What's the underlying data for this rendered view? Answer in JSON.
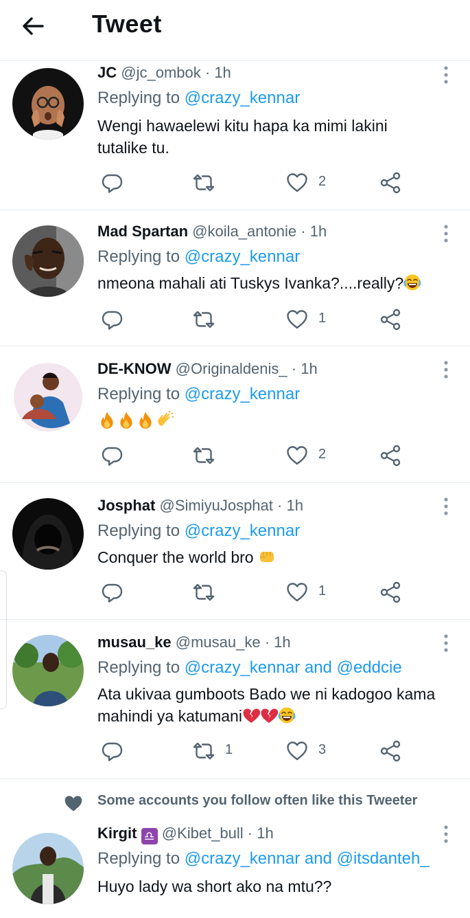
{
  "header": {
    "title": "Tweet"
  },
  "replies": [
    {
      "name": "JC",
      "handle": "@jc_ombok",
      "time": "· 1h",
      "replying_prefix": "Replying to",
      "replying_to": "@crazy_kennar",
      "text_lines": [
        "Wengi hawaelewi kitu hapa ka mimi lakini",
        "tutalike tu."
      ],
      "retweets": "",
      "likes": "2"
    },
    {
      "name": "Mad Spartan",
      "handle": "@koila_antonie",
      "time": "· 1h",
      "replying_prefix": "Replying to",
      "replying_to": "@crazy_kennar",
      "text": "nmeona mahali ati Tuskys Ivanka?....really?",
      "retweets": "",
      "likes": "1"
    },
    {
      "name": "DE-KNOW",
      "handle": "@Originaldenis_",
      "time": "· 1h",
      "replying_prefix": "Replying to",
      "replying_to": "@crazy_kennar",
      "text": "",
      "retweets": "",
      "likes": "2"
    },
    {
      "name": "Josphat",
      "handle": "@SimiyuJosphat",
      "time": "· 1h",
      "replying_prefix": "Replying to",
      "replying_to": "@crazy_kennar",
      "text": "Conquer the world bro",
      "retweets": "",
      "likes": "1"
    },
    {
      "name": "musau_ke",
      "handle": "@musau_ke",
      "time": "· 1h",
      "replying_prefix": "Replying to",
      "replying_to": "@crazy_kennar",
      "and": "and",
      "replying_to_2": "@eddcie",
      "text_lines": [
        "Ata ukivaa gumboots Bado we ni kadogoo kama",
        "mahindi ya katumani"
      ],
      "retweets": "1",
      "likes": "3"
    },
    {
      "name": "Kirgit",
      "handle": "@Kibet_bull",
      "time": "· 1h",
      "replying_prefix": "Replying to",
      "replying_to": "@crazy_kennar",
      "and": "and",
      "replying_to_2": "@itsdanteh_",
      "text": "Huyo lady wa short ako na mtu??"
    }
  ],
  "social_context": {
    "text": "Some accounts you follow often like this Tweeter"
  },
  "colors": {
    "link": "#1d9bf0",
    "muted": "#536471",
    "text": "#0f1419",
    "divider": "#e6ecf0"
  },
  "icons": [
    "back-arrow-icon",
    "more-vertical-icon",
    "reply-icon",
    "retweet-icon",
    "like-icon",
    "share-icon",
    "heart-filled-icon"
  ]
}
